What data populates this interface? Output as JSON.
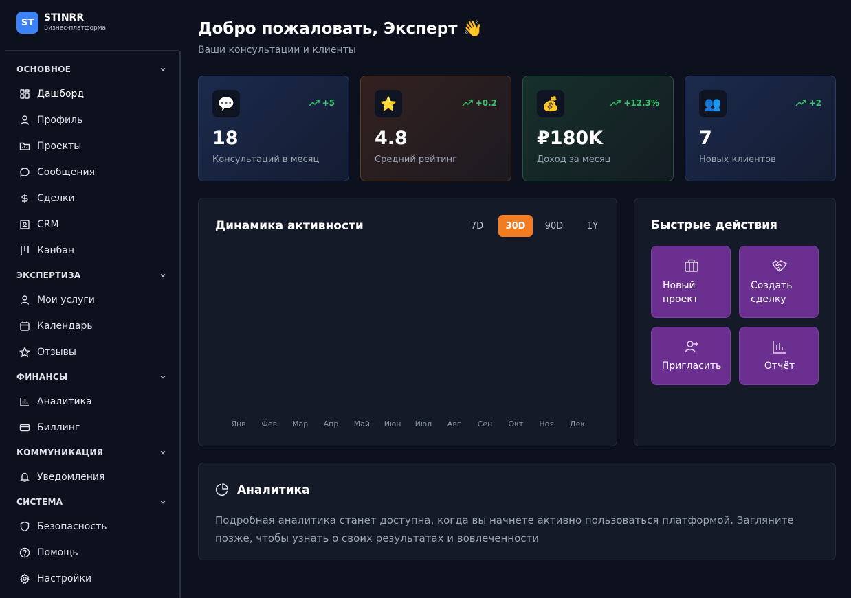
{
  "brand": {
    "logo": "ST",
    "name": "STINRR",
    "subtitle": "Бизнес-платформа"
  },
  "sidebar": {
    "sections": [
      {
        "title": "ОСНОВНОЕ",
        "items": [
          {
            "label": "Дашборд",
            "icon": "dashboard-icon"
          },
          {
            "label": "Профиль",
            "icon": "user-icon"
          },
          {
            "label": "Проекты",
            "icon": "folder-icon"
          },
          {
            "label": "Сообщения",
            "icon": "message-icon"
          },
          {
            "label": "Сделки",
            "icon": "dollar-icon"
          },
          {
            "label": "CRM",
            "icon": "contact-icon"
          },
          {
            "label": "Канбан",
            "icon": "kanban-icon"
          }
        ]
      },
      {
        "title": "ЭКСПЕРТИЗА",
        "items": [
          {
            "label": "Мои услуги",
            "icon": "user-icon"
          },
          {
            "label": "Календарь",
            "icon": "calendar-icon"
          },
          {
            "label": "Отзывы",
            "icon": "star-icon"
          }
        ]
      },
      {
        "title": "ФИНАНСЫ",
        "items": [
          {
            "label": "Аналитика",
            "icon": "bar-chart-icon"
          },
          {
            "label": "Биллинг",
            "icon": "credit-card-icon"
          }
        ]
      },
      {
        "title": "КОММУНИКАЦИЯ",
        "items": [
          {
            "label": "Уведомления",
            "icon": "bell-icon"
          }
        ]
      },
      {
        "title": "СИСТЕМА",
        "items": [
          {
            "label": "Безопасность",
            "icon": "shield-icon"
          },
          {
            "label": "Помощь",
            "icon": "help-icon"
          },
          {
            "label": "Настройки",
            "icon": "gear-icon"
          }
        ]
      }
    ]
  },
  "header": {
    "title": "Добро пожаловать, Эксперт 👋",
    "subtitle": "Ваши консультации и клиенты"
  },
  "stats": [
    {
      "icon": "💬",
      "trend": "+5",
      "value": "18",
      "label": "Консультаций в месяц"
    },
    {
      "icon": "⭐",
      "trend": "+0.2",
      "value": "4.8",
      "label": "Средний рейтинг"
    },
    {
      "icon": "💰",
      "trend": "+12.3%",
      "value": "₽180K",
      "label": "Доход за месяц"
    },
    {
      "icon": "👥",
      "trend": "+2",
      "value": "7",
      "label": "Новых клиентов"
    }
  ],
  "activity": {
    "title": "Динамика активности",
    "ranges": [
      "7D",
      "30D",
      "90D",
      "1Y"
    ],
    "selected_range": "30D",
    "accent": "#f47c20"
  },
  "chart_data": {
    "type": "area",
    "title": "Динамика активности",
    "categories": [
      "Янв",
      "Фев",
      "Мар",
      "Апр",
      "Май",
      "Июн",
      "Июл",
      "Авг",
      "Сен",
      "Окт",
      "Ноя",
      "Дек"
    ],
    "series": [],
    "grid": false
  },
  "quick_actions": {
    "title": "Быстрые действия",
    "buttons": [
      {
        "label_line1": "Новый",
        "label_line2": "проект",
        "icon": "briefcase-icon"
      },
      {
        "label_line1": "Создать",
        "label_line2": "сделку",
        "icon": "handshake-icon"
      },
      {
        "label": "Пригласить",
        "icon": "user-plus-icon"
      },
      {
        "label": "Отчёт",
        "icon": "bar-chart-icon"
      }
    ],
    "color": "#6a2f8f"
  },
  "analytics": {
    "title": "Аналитика",
    "text": "Подробная аналитика станет доступна, когда вы начнете активно пользоваться платформой. Загляните позже, чтобы узнать о своих результатах и вовлеченности"
  }
}
